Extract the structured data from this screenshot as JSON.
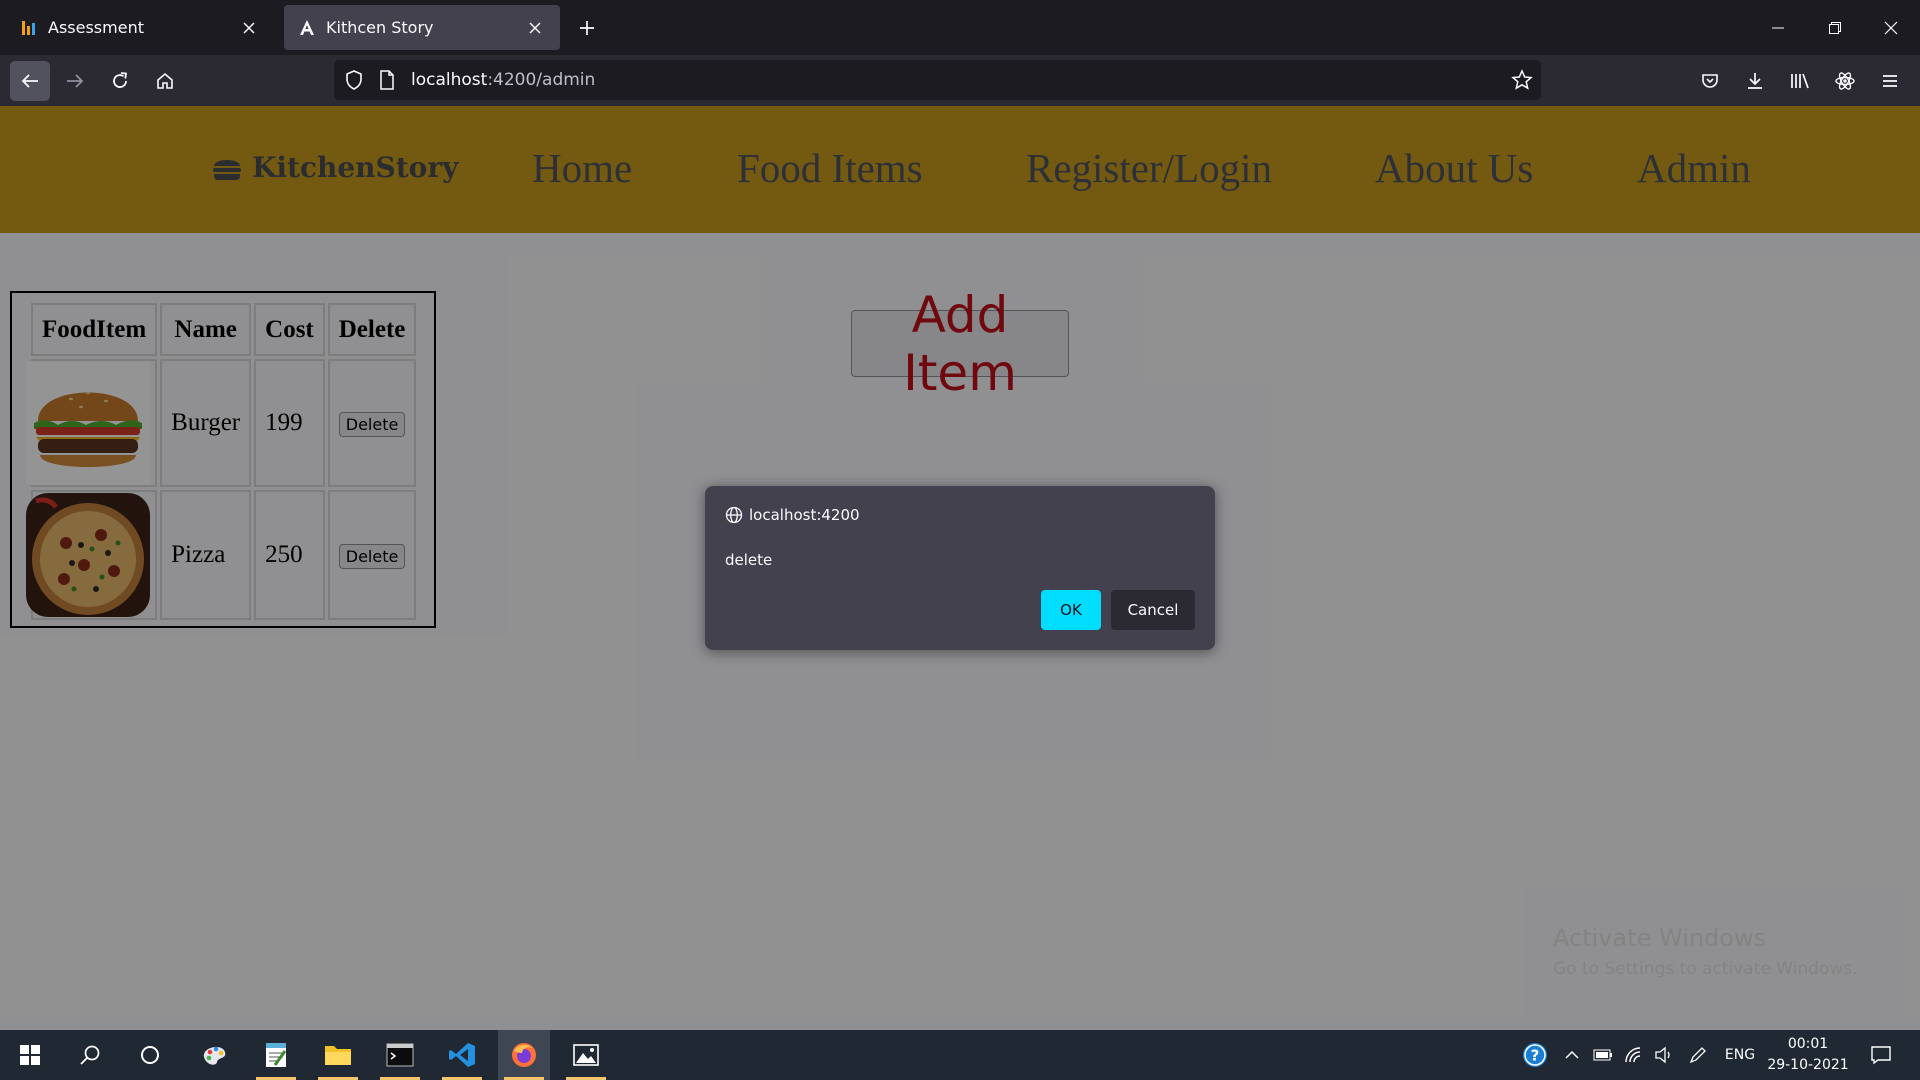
{
  "browser": {
    "tabs": [
      {
        "title": "Assessment",
        "active": false
      },
      {
        "title": "Kithcen Story",
        "active": true
      }
    ],
    "url": {
      "host": "localhost",
      "path": ":4200/admin"
    }
  },
  "site": {
    "brand": "KitchenStory",
    "nav": [
      "Home",
      "Food Items",
      "Register/Login",
      "About Us",
      "Admin"
    ],
    "table": {
      "headers": [
        "FoodItem",
        "Name",
        "Cost",
        "Delete"
      ],
      "rows": [
        {
          "name": "Burger",
          "cost": "199",
          "action": "Delete"
        },
        {
          "name": "Pizza",
          "cost": "250",
          "action": "Delete"
        }
      ]
    },
    "add_item_label": "Add Item"
  },
  "dialog": {
    "origin": "localhost:4200",
    "message": "delete",
    "ok_label": "OK",
    "cancel_label": "Cancel"
  },
  "watermark": {
    "line1": "Activate Windows",
    "line2": "Go to Settings to activate Windows."
  },
  "taskbar": {
    "language": "ENG",
    "time": "00:01",
    "date": "29-10-2021"
  },
  "colors": {
    "header": "#c99b1c",
    "add_item_text": "#c0101a",
    "ok_button": "#00ddff"
  }
}
